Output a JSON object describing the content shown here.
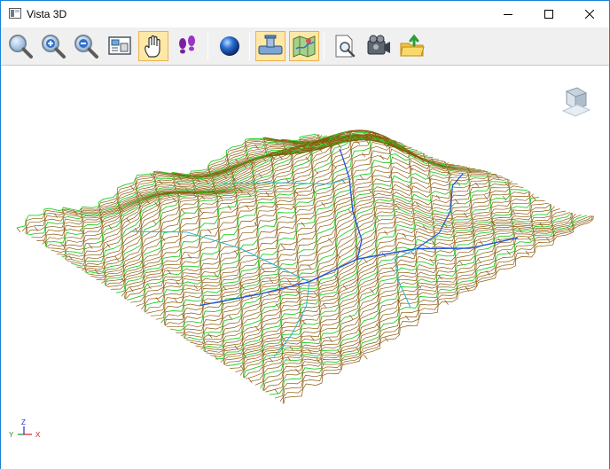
{
  "window": {
    "title": "Vista 3D",
    "controls": [
      "minimize",
      "maximize",
      "close"
    ]
  },
  "toolbar": {
    "buttons": [
      {
        "name": "zoom-window",
        "icon": "magnifier-icon",
        "active": false
      },
      {
        "name": "zoom-in",
        "icon": "zoom-in-icon",
        "active": false
      },
      {
        "name": "zoom-out",
        "icon": "zoom-out-icon",
        "active": false
      },
      {
        "name": "zoom-extents",
        "icon": "zoom-extents-icon",
        "active": false
      },
      {
        "name": "pan",
        "icon": "hand-icon",
        "active": true
      },
      {
        "name": "walk",
        "icon": "footprints-icon",
        "active": false
      },
      {
        "name": "sphere",
        "icon": "sphere-icon",
        "active": false
      },
      {
        "name": "pipes",
        "icon": "pipe-icon",
        "active": true
      },
      {
        "name": "map",
        "icon": "map-icon",
        "active": true
      },
      {
        "name": "preview",
        "icon": "preview-icon",
        "active": false
      },
      {
        "name": "camera",
        "icon": "video-camera-icon",
        "active": false
      },
      {
        "name": "export",
        "icon": "export-folder-icon",
        "active": false
      }
    ]
  },
  "viewport": {
    "axes": {
      "x": "X",
      "y": "Y",
      "z": "Z"
    },
    "colors": {
      "contour_major": "#22cc22",
      "contour_minor": "#8a5a0c",
      "river": "#2255dd",
      "stream": "#22b7c9",
      "axis_x": "#d42020",
      "axis_y": "#1c8c1c",
      "axis_z": "#2a2acc"
    }
  }
}
